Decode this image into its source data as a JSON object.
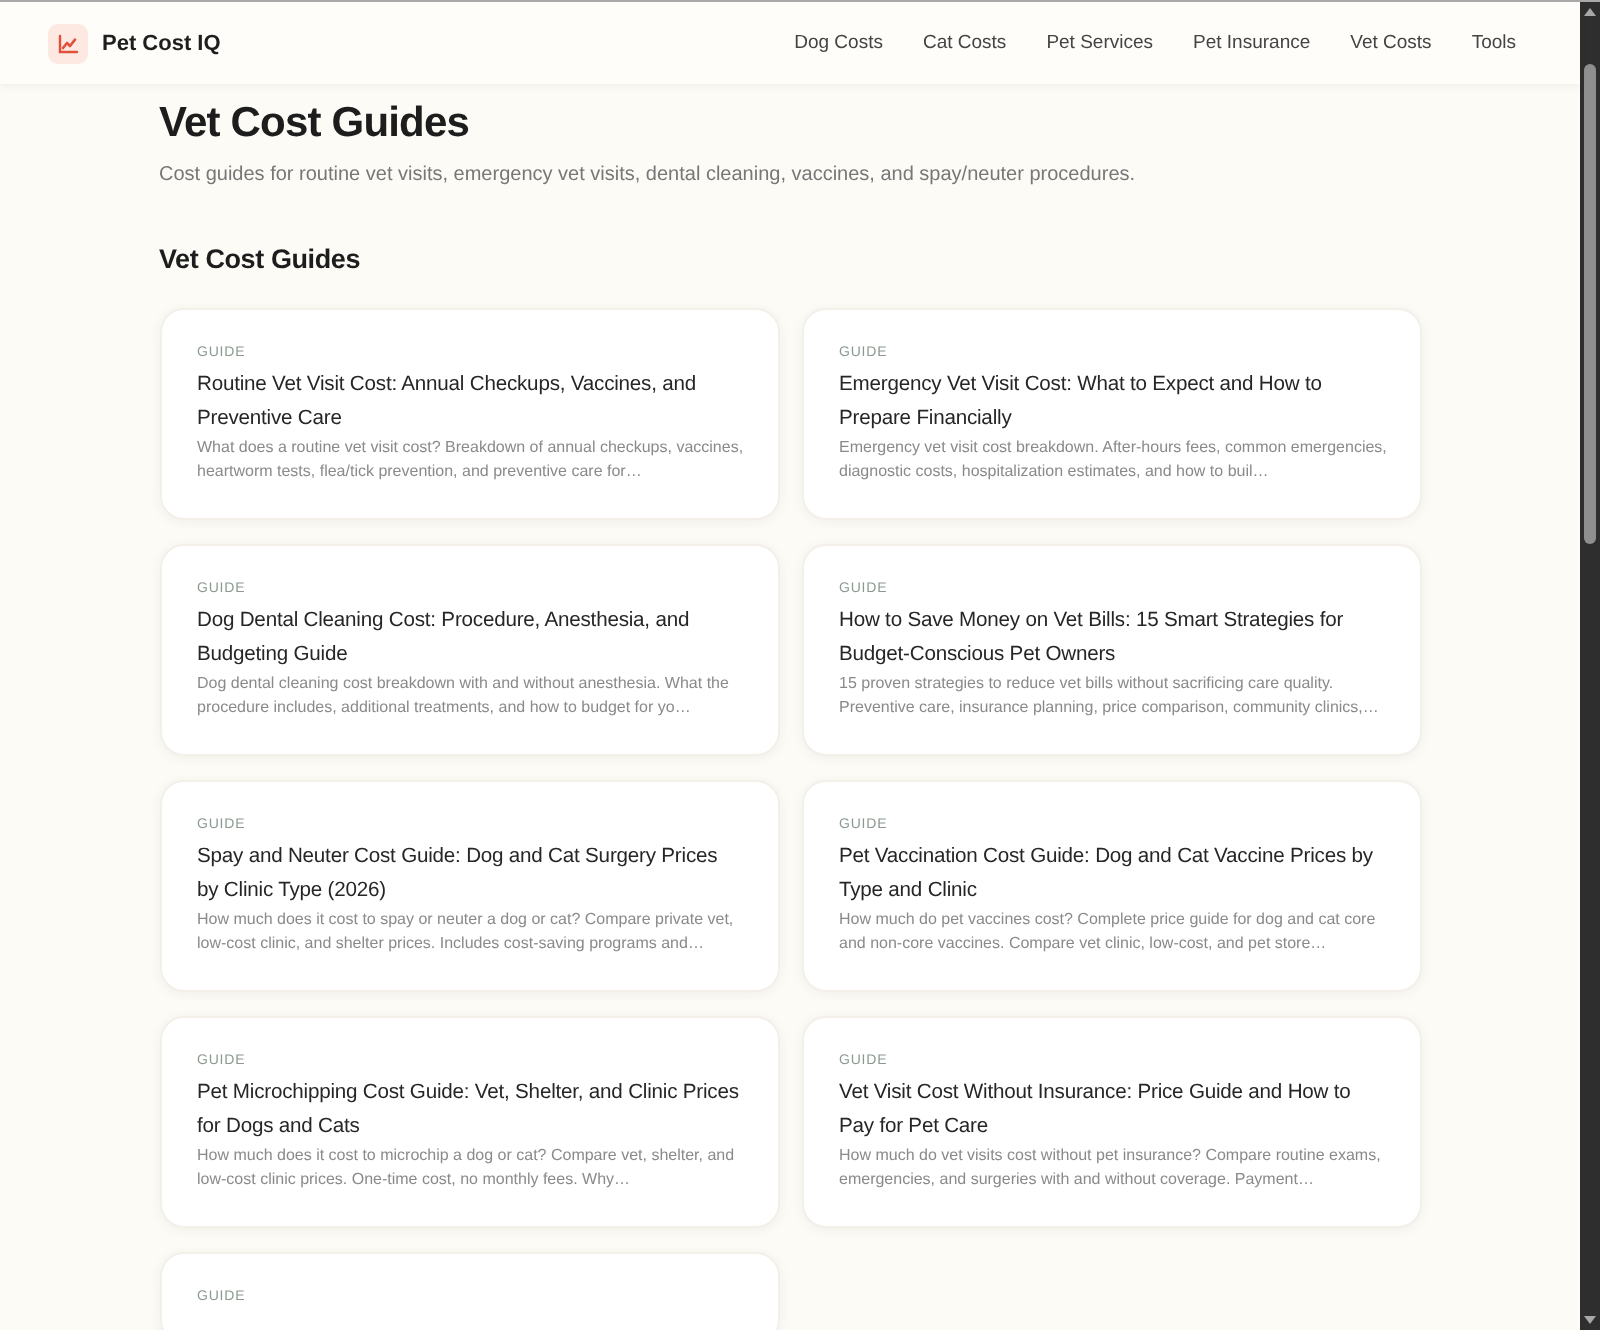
{
  "header": {
    "brand": "Pet Cost IQ",
    "nav": [
      "Dog Costs",
      "Cat Costs",
      "Pet Services",
      "Pet Insurance",
      "Vet Costs",
      "Tools"
    ]
  },
  "page": {
    "title": "Vet Cost Guides",
    "subtitle": "Cost guides for routine vet visits, emergency vet visits, dental cleaning, vaccines, and spay/neuter procedures."
  },
  "section": {
    "heading": "Vet Cost Guides",
    "cards": [
      {
        "label": "GUIDE",
        "title": "Routine Vet Visit Cost: Annual Checkups, Vaccines, and Preventive Care",
        "description": "What does a routine vet visit cost? Breakdown of annual checkups, vaccines, heartworm tests, flea/tick prevention, and preventive care for…"
      },
      {
        "label": "GUIDE",
        "title": "Emergency Vet Visit Cost: What to Expect and How to Prepare Financially",
        "description": "Emergency vet visit cost breakdown. After-hours fees, common emergencies, diagnostic costs, hospitalization estimates, and how to buil…"
      },
      {
        "label": "GUIDE",
        "title": "Dog Dental Cleaning Cost: Procedure, Anesthesia, and Budgeting Guide",
        "description": "Dog dental cleaning cost breakdown with and without anesthesia. What the procedure includes, additional treatments, and how to budget for yo…"
      },
      {
        "label": "GUIDE",
        "title": "How to Save Money on Vet Bills: 15 Smart Strategies for Budget-Conscious Pet Owners",
        "description": "15 proven strategies to reduce vet bills without sacrificing care quality. Preventive care, insurance planning, price comparison, community clinics,…"
      },
      {
        "label": "GUIDE",
        "title": "Spay and Neuter Cost Guide: Dog and Cat Surgery Prices by Clinic Type (2026)",
        "description": "How much does it cost to spay or neuter a dog or cat? Compare private vet, low-cost clinic, and shelter prices. Includes cost-saving programs and…"
      },
      {
        "label": "GUIDE",
        "title": "Pet Vaccination Cost Guide: Dog and Cat Vaccine Prices by Type and Clinic",
        "description": "How much do pet vaccines cost? Complete price guide for dog and cat core and non-core vaccines. Compare vet clinic, low-cost, and pet store…"
      },
      {
        "label": "GUIDE",
        "title": "Pet Microchipping Cost Guide: Vet, Shelter, and Clinic Prices for Dogs and Cats",
        "description": "How much does it cost to microchip a dog or cat? Compare vet, shelter, and low-cost clinic prices. One-time cost, no monthly fees. Why…"
      },
      {
        "label": "GUIDE",
        "title": "Vet Visit Cost Without Insurance: Price Guide and How to Pay for Pet Care",
        "description": "How much do vet visits cost without pet insurance? Compare routine exams, emergencies, and surgeries with and without coverage. Payment…"
      },
      {
        "label": "GUIDE"
      }
    ]
  }
}
